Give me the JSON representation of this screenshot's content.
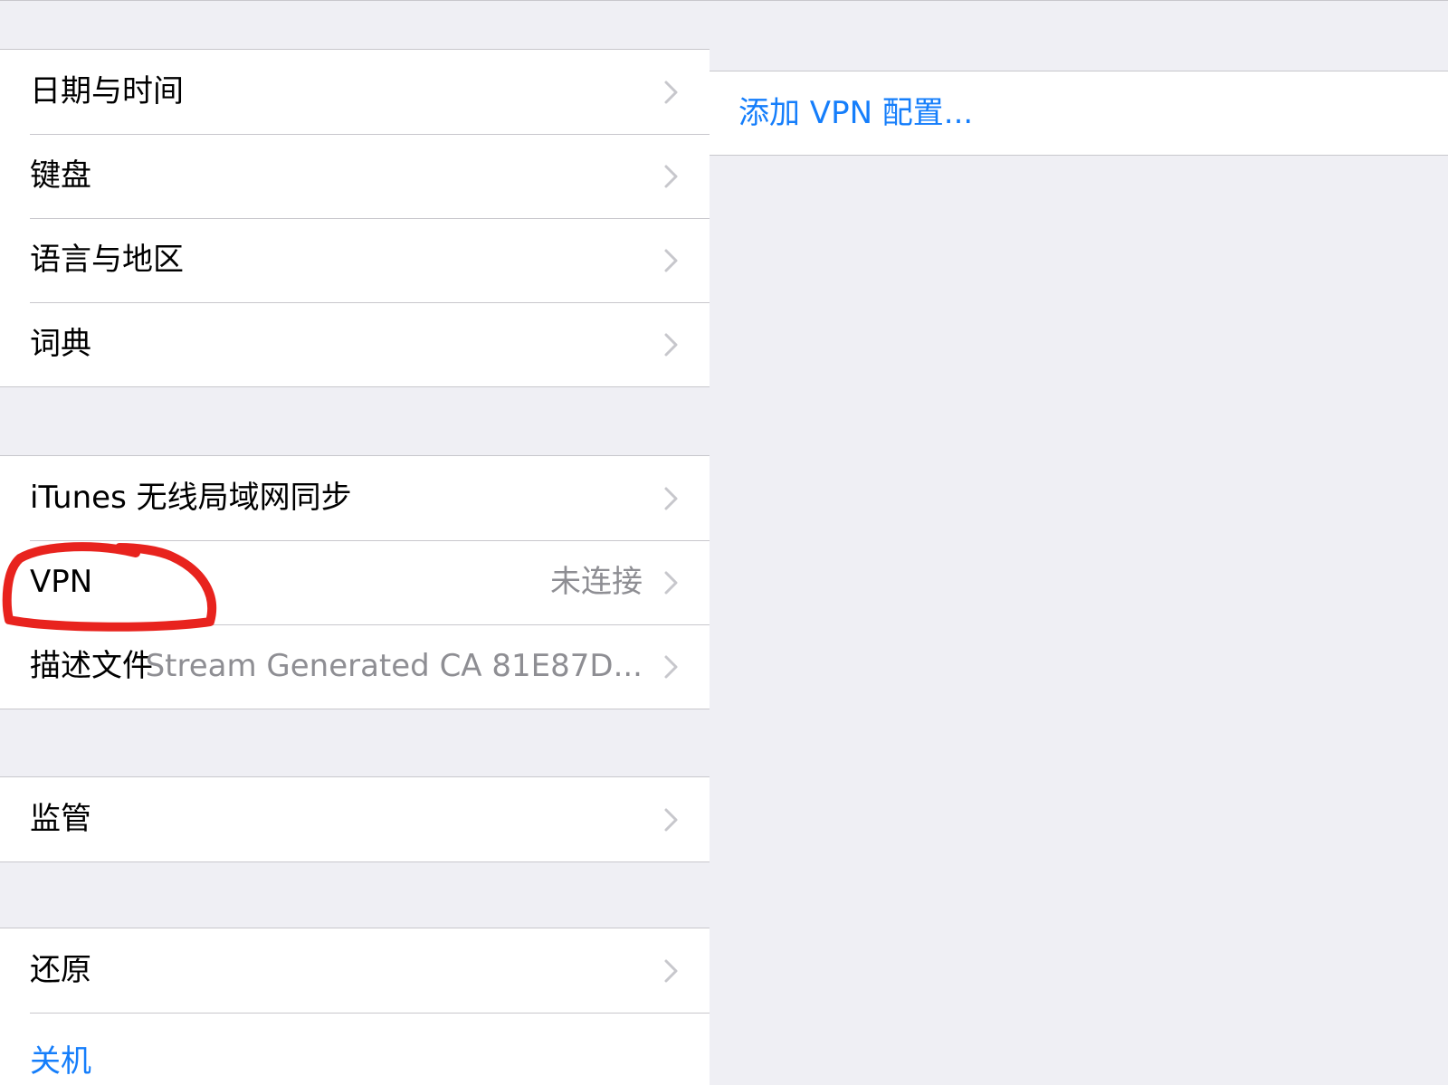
{
  "left": {
    "group1": [
      {
        "label": "日期与时间"
      },
      {
        "label": "键盘"
      },
      {
        "label": "语言与地区"
      },
      {
        "label": "词典"
      }
    ],
    "group2": [
      {
        "label": "iTunes 无线局域网同步"
      },
      {
        "label": "VPN",
        "value": "未连接"
      },
      {
        "label": "描述文件",
        "value": "Stream Generated CA 81E87D..."
      }
    ],
    "group3": [
      {
        "label": "监管"
      }
    ],
    "group4": [
      {
        "label": "还原"
      },
      {
        "label": "关机"
      }
    ]
  },
  "right": {
    "add_vpn_label": "添加 VPN 配置..."
  },
  "colors": {
    "accent": "#157efb",
    "annotation": "#e8231e",
    "background": "#efeff4",
    "secondary_text": "#8e8e93"
  },
  "icons": {
    "row_chevron": "chevron-right-icon"
  }
}
